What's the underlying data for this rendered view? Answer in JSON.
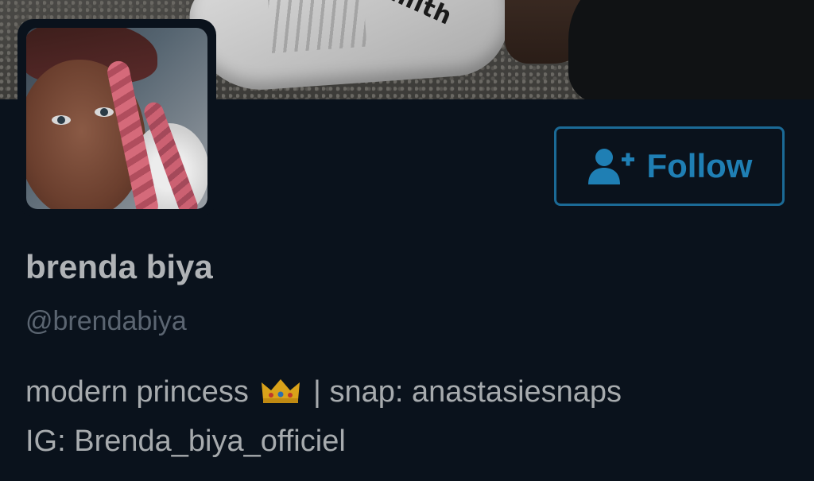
{
  "profile": {
    "display_name": "brenda biya",
    "handle": "@brendabiya",
    "bio": {
      "line1_before": "modern princess",
      "emoji_icon": "crown-icon",
      "line1_after": "| snap: anastasiesnaps",
      "line2": "IG: Brenda_biya_officiel"
    }
  },
  "banner": {
    "shoe_logo_text": "Smith"
  },
  "actions": {
    "follow_label": "Follow",
    "follow_icon": "add-user-icon"
  },
  "colors": {
    "background": "#0a121c",
    "accent": "#1f7fb4",
    "name_text": "#b0b3b6",
    "handle_text": "#5b6571",
    "bio_text": "#a7abae"
  }
}
